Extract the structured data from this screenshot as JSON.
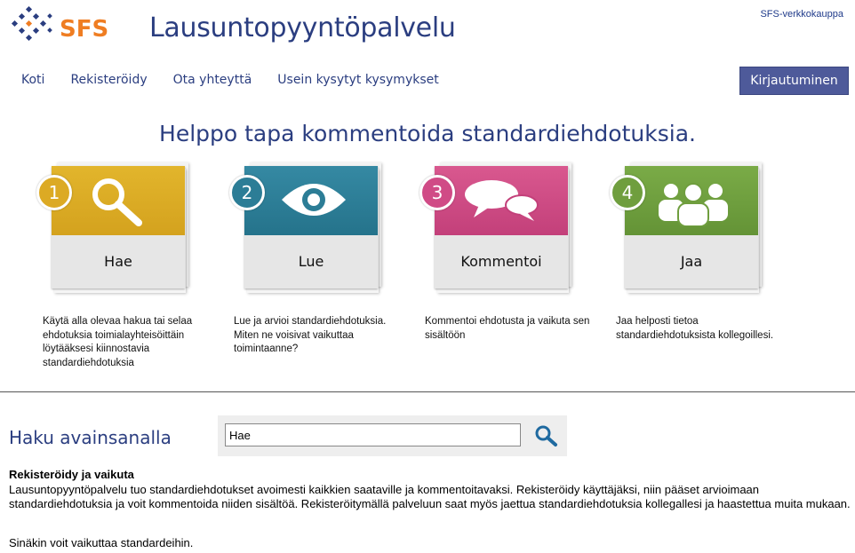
{
  "header": {
    "logo_text": "SFS",
    "title": "Lausuntopyyntöpalvelu",
    "shop_link": "SFS-verkkokauppa"
  },
  "nav": {
    "items": [
      {
        "label": "Koti"
      },
      {
        "label": "Rekisteröidy"
      },
      {
        "label": "Ota yhteyttä"
      },
      {
        "label": "Usein kysytyt kysymykset"
      }
    ],
    "login_label": "Kirjautuminen"
  },
  "headline": "Helppo tapa kommentoida standardiehdotuksia.",
  "steps": [
    {
      "number": "1",
      "label": "Hae",
      "icon": "search-icon",
      "color": "#dcaa24",
      "description": "Käytä alla olevaa hakua tai selaa ehdotuksia toimialayhteisöittäin löytääksesi kiinnostavia standardiehdotuksia"
    },
    {
      "number": "2",
      "label": "Lue",
      "icon": "eye-icon",
      "color": "#2c7d96",
      "description": "Lue ja arvioi standardiehdotuksia. Miten ne voisivat vaikuttaa toimintaanne?"
    },
    {
      "number": "3",
      "label": "Kommentoi",
      "icon": "speech-bubbles-icon",
      "color": "#d04b86",
      "description": "Kommentoi ehdotusta ja vaikuta sen sisältöön"
    },
    {
      "number": "4",
      "label": "Jaa",
      "icon": "people-icon",
      "color": "#6f9e3e",
      "description": "Jaa helposti tietoa standardiehdotuksista kollegoillesi."
    }
  ],
  "search": {
    "title": "Haku avainsanalla",
    "value": "Hae"
  },
  "info": {
    "title": "Rekisteröidy ja vaikuta",
    "text": "Lausuntopyyntöpalvelu tuo standardiehdotukset avoimesti kaikkien saataville ja kommentoitavaksi. Rekisteröidy käyttäjäksi, niin pääset arvioimaan standardiehdotuksia ja voit kommentoida niiden sisältöä. Rekisteröitymällä palveluun saat myös jaettua standardiehdotuksia kollegallesi ja haastettua muita mukaan.",
    "text2": "Sinäkin voit vaikuttaa standardeihin."
  },
  "colors": {
    "brand_blue": "#2b3e80",
    "logo_orange": "#ef7d22",
    "login_bg": "#4e5a9a"
  }
}
